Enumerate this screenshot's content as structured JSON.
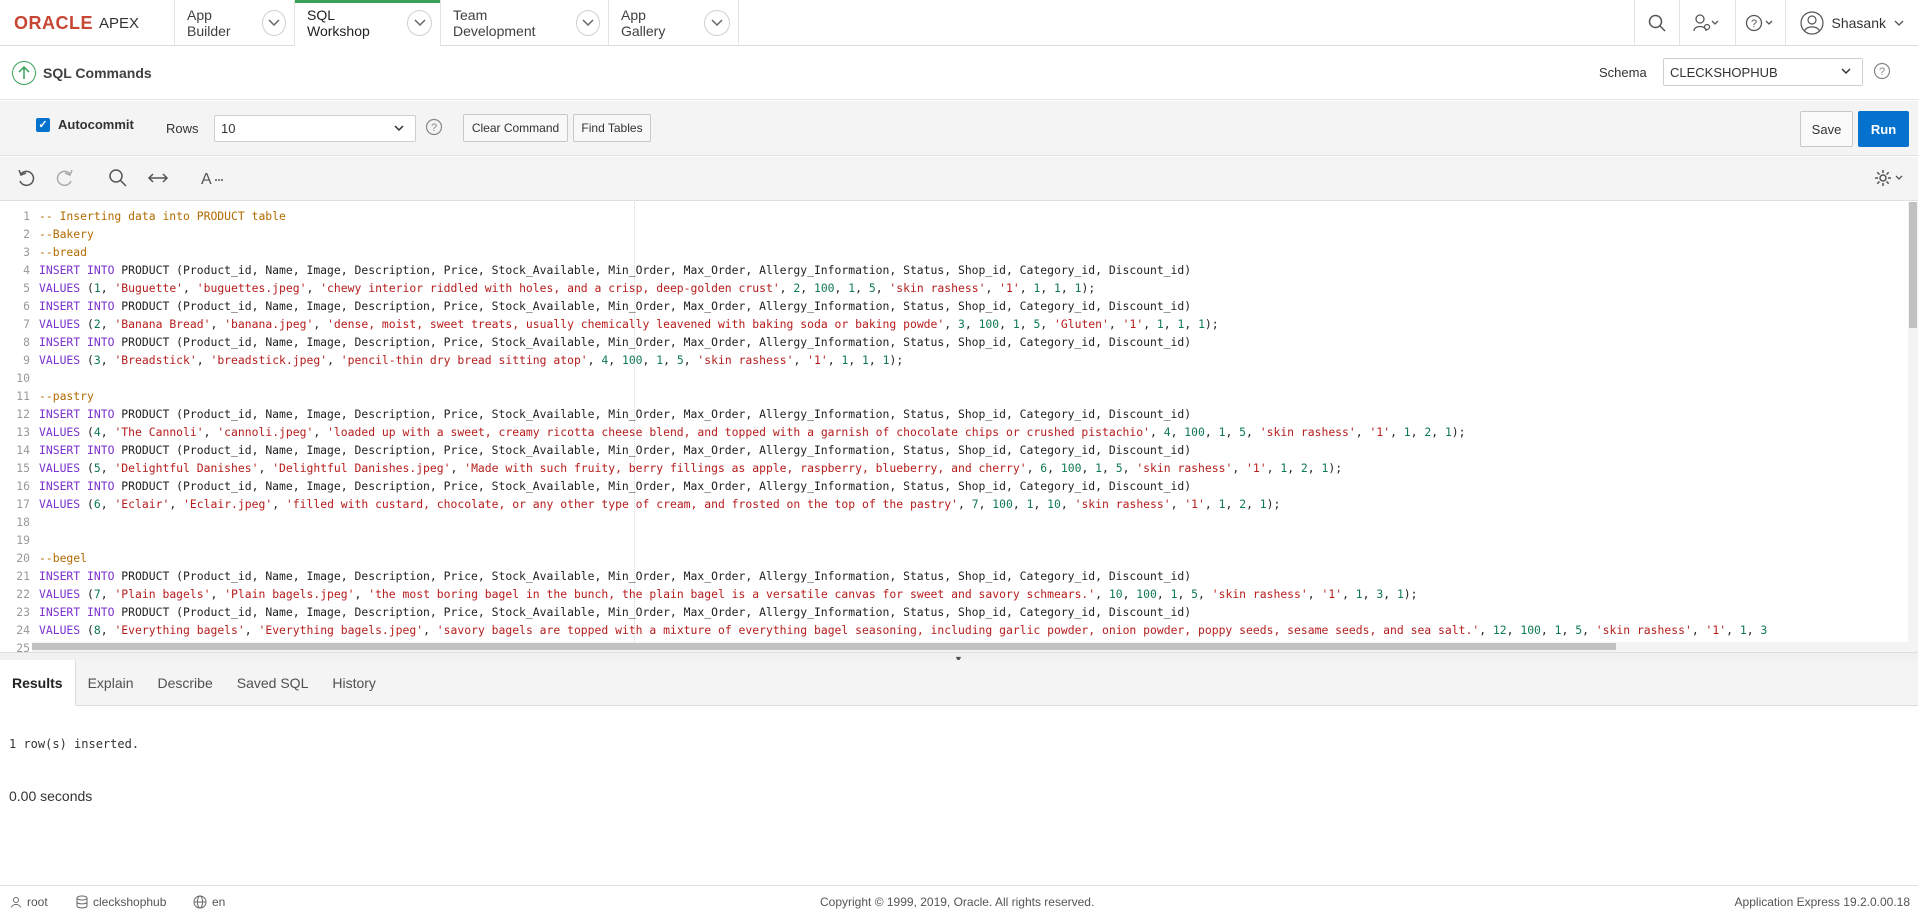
{
  "brand": {
    "oracle": "ORACLE",
    "apex": "APEX"
  },
  "nav": {
    "tabs": [
      {
        "label": "App Builder"
      },
      {
        "label": "SQL Workshop",
        "active": true
      },
      {
        "label": "Team Development"
      },
      {
        "label": "App Gallery"
      }
    ],
    "user": "Shasank",
    "icons": [
      "search-icon",
      "admin-user-icon",
      "help-icon",
      "avatar-icon"
    ]
  },
  "page": {
    "title": "SQL Commands"
  },
  "schema": {
    "label": "Schema",
    "value": "CLECKSHOPHUB"
  },
  "toolbar": {
    "autocommit_label": "Autocommit",
    "autocommit_checked": true,
    "rows_label": "Rows",
    "rows_value": "10",
    "clear_label": "Clear Command",
    "find_label": "Find Tables",
    "save_label": "Save",
    "run_label": "Run"
  },
  "editor": {
    "tools": [
      "undo-icon",
      "redo-icon",
      "search-icon",
      "wrap-icon",
      "font-size-icon",
      "settings-icon"
    ],
    "lines": [
      {
        "n": "1",
        "t": "-- Inserting data into PRODUCT table"
      },
      {
        "n": "2",
        "t": "--Bakery"
      },
      {
        "n": "3",
        "t": "--bread"
      },
      {
        "n": "4",
        "t": "INSERT INTO PRODUCT (Product_id, Name, Image, Description, Price, Stock_Available, Min_Order, Max_Order, Allergy_Information, Status, Shop_id, Category_id, Discount_id)"
      },
      {
        "n": "5",
        "t": "VALUES (1, 'Buguette', 'buguettes.jpeg', 'chewy interior riddled with holes, and a crisp, deep-golden crust', 2, 100, 1, 5, 'skin rashess', '1', 1, 1, 1);"
      },
      {
        "n": "6",
        "t": "INSERT INTO PRODUCT (Product_id, Name, Image, Description, Price, Stock_Available, Min_Order, Max_Order, Allergy_Information, Status, Shop_id, Category_id, Discount_id)"
      },
      {
        "n": "7",
        "t": "VALUES (2, 'Banana Bread', 'banana.jpeg', 'dense, moist, sweet treats, usually chemically leavened with baking soda or baking powde', 3, 100, 1, 5, 'Gluten', '1', 1, 1, 1);"
      },
      {
        "n": "8",
        "t": "INSERT INTO PRODUCT (Product_id, Name, Image, Description, Price, Stock_Available, Min_Order, Max_Order, Allergy_Information, Status, Shop_id, Category_id, Discount_id)"
      },
      {
        "n": "9",
        "t": "VALUES (3, 'Breadstick', 'breadstick.jpeg', 'pencil-thin dry bread sitting atop', 4, 100, 1, 5, 'skin rashess', '1', 1, 1, 1);"
      },
      {
        "n": "10",
        "t": ""
      },
      {
        "n": "11",
        "t": "--pastry"
      },
      {
        "n": "12",
        "t": "INSERT INTO PRODUCT (Product_id, Name, Image, Description, Price, Stock_Available, Min_Order, Max_Order, Allergy_Information, Status, Shop_id, Category_id, Discount_id)"
      },
      {
        "n": "13",
        "t": "VALUES (4, 'The Cannoli', 'cannoli.jpeg', 'loaded up with a sweet, creamy ricotta cheese blend, and topped with a garnish of chocolate chips or crushed pistachio', 4, 100, 1, 5, 'skin rashess', '1', 1, 2, 1);"
      },
      {
        "n": "14",
        "t": "INSERT INTO PRODUCT (Product_id, Name, Image, Description, Price, Stock_Available, Min_Order, Max_Order, Allergy_Information, Status, Shop_id, Category_id, Discount_id)"
      },
      {
        "n": "15",
        "t": "VALUES (5, 'Delightful Danishes', 'Delightful Danishes.jpeg', 'Made with such fruity, berry fillings as apple, raspberry, blueberry, and cherry', 6, 100, 1, 5, 'skin rashess', '1', 1, 2, 1);"
      },
      {
        "n": "16",
        "t": "INSERT INTO PRODUCT (Product_id, Name, Image, Description, Price, Stock_Available, Min_Order, Max_Order, Allergy_Information, Status, Shop_id, Category_id, Discount_id)"
      },
      {
        "n": "17",
        "t": "VALUES (6, 'Eclair', 'Eclair.jpeg', 'filled with custard, chocolate, or any other type of cream, and frosted on the top of the pastry', 7, 100, 1, 10, 'skin rashess', '1', 1, 2, 1);"
      },
      {
        "n": "18",
        "t": ""
      },
      {
        "n": "19",
        "t": ""
      },
      {
        "n": "20",
        "t": "--begel"
      },
      {
        "n": "21",
        "t": "INSERT INTO PRODUCT (Product_id, Name, Image, Description, Price, Stock_Available, Min_Order, Max_Order, Allergy_Information, Status, Shop_id, Category_id, Discount_id)"
      },
      {
        "n": "22",
        "t": "VALUES (7, 'Plain bagels', 'Plain bagels.jpeg', 'the most boring bagel in the bunch, the plain bagel is a versatile canvas for sweet and savory schmears.', 10, 100, 1, 5, 'skin rashess', '1', 1, 3, 1);"
      },
      {
        "n": "23",
        "t": "INSERT INTO PRODUCT (Product_id, Name, Image, Description, Price, Stock_Available, Min_Order, Max_Order, Allergy_Information, Status, Shop_id, Category_id, Discount_id)"
      },
      {
        "n": "24",
        "t": "VALUES (8, 'Everything bagels', 'Everything bagels.jpeg', 'savory bagels are topped with a mixture of everything bagel seasoning, including garlic powder, onion powder, poppy seeds, sesame seeds, and sea salt.', 12, 100, 1, 5, 'skin rashess', '1', 1, 3"
      },
      {
        "n": "25",
        "t": ""
      }
    ]
  },
  "results": {
    "tabs": [
      {
        "label": "Results",
        "active": true
      },
      {
        "label": "Explain"
      },
      {
        "label": "Describe"
      },
      {
        "label": "Saved SQL"
      },
      {
        "label": "History"
      }
    ],
    "message": "1 row(s) inserted.",
    "timing": "0.00 seconds"
  },
  "footer": {
    "user": "root",
    "schema": "cleckshophub",
    "language": "en",
    "copyright": "Copyright © 1999, 2019, Oracle. All rights reserved.",
    "version": "Application Express 19.2.0.00.18"
  },
  "colors": {
    "accent": "#0572ce",
    "brand": "#c74634",
    "active_tab": "#39a05a",
    "comment": "#b36b00",
    "keyword": "#7b30d0",
    "string": "#b71c1c",
    "number": "#0e7a50"
  }
}
